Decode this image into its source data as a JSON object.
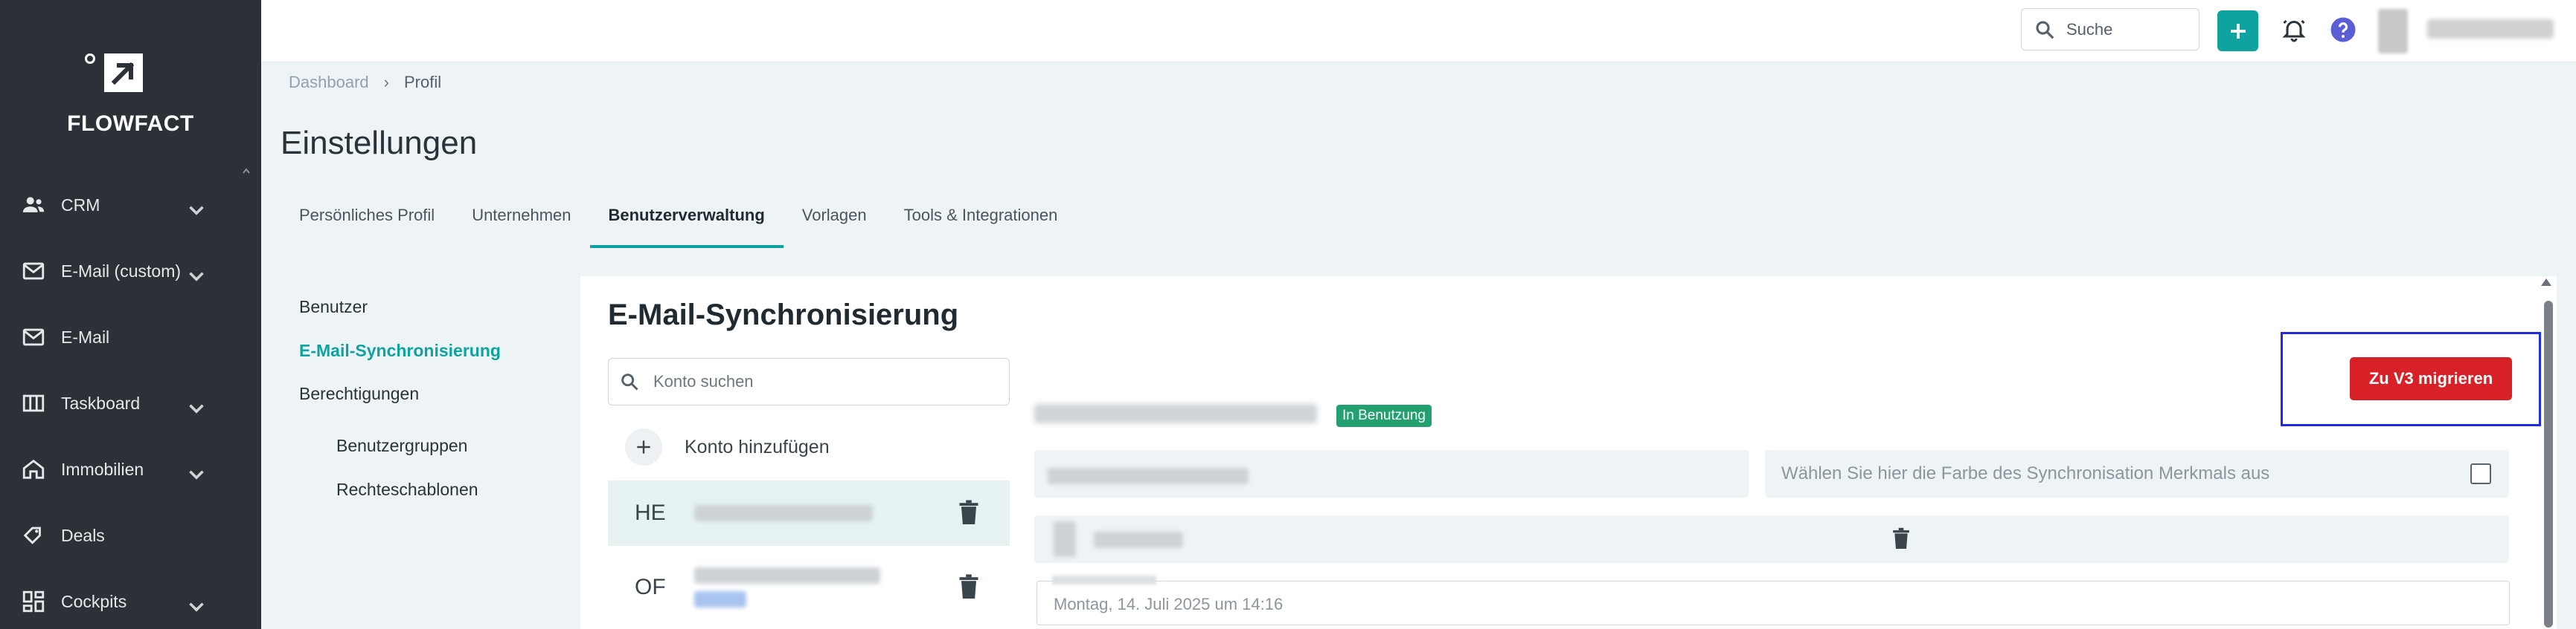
{
  "brand": {
    "name": "FLOWFACT"
  },
  "sidebar": {
    "items": [
      {
        "label": "CRM",
        "icon": "people-icon"
      },
      {
        "label": "E-Mail (custom)",
        "icon": "mail-icon"
      },
      {
        "label": "E-Mail",
        "icon": "mail-icon"
      },
      {
        "label": "Taskboard",
        "icon": "board-icon"
      },
      {
        "label": "Immobilien",
        "icon": "home-icon"
      },
      {
        "label": "Deals",
        "icon": "deal-icon"
      },
      {
        "label": "Cockpits",
        "icon": "dashboard-icon"
      }
    ]
  },
  "topbar": {
    "search_placeholder": "Suche"
  },
  "breadcrumb": {
    "root": "Dashboard",
    "current": "Profil"
  },
  "page": {
    "title": "Einstellungen"
  },
  "tabs": [
    {
      "label": "Persönliches Profil"
    },
    {
      "label": "Unternehmen"
    },
    {
      "label": "Benutzerverwaltung",
      "active": true
    },
    {
      "label": "Vorlagen"
    },
    {
      "label": "Tools & Integrationen"
    }
  ],
  "settings_nav": {
    "users": "Benutzer",
    "email_sync": "E-Mail-Synchronisierung",
    "permissions": "Berechtigungen",
    "user_groups": "Benutzergruppen",
    "rights_templates": "Rechteschablonen"
  },
  "panel": {
    "title": "E-Mail-Synchronisierung",
    "account_search_placeholder": "Konto suchen",
    "add_account": "Konto hinzufügen",
    "accounts": [
      {
        "initials": "HE"
      },
      {
        "initials": "OF"
      }
    ],
    "status_badge": "In Benutzung",
    "color_placeholder": "Wählen Sie hier die Farbe des Synchronisation Merkmals aus",
    "date_value": "Montag, 14. Juli 2025 um 14:16",
    "migrate_button": "Zu V3 migrieren"
  },
  "colors": {
    "accent": "#0fa3a0",
    "danger": "#d82127",
    "sidebar": "#2b3137"
  }
}
